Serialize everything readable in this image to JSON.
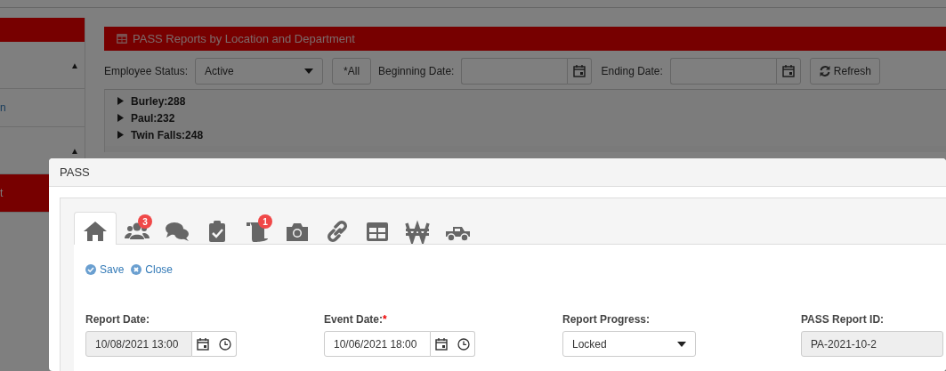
{
  "sidebar": {
    "items": [
      {
        "kind": "group",
        "caret": "▲",
        "selected": false
      },
      {
        "kind": "link",
        "label": "n",
        "selected": false
      },
      {
        "kind": "group",
        "caret": "▲",
        "selected": false
      },
      {
        "kind": "link",
        "label": "t",
        "selected": true
      }
    ]
  },
  "panel": {
    "title": "PASS Reports by Location and Department",
    "filters": {
      "employee_status": {
        "label": "Employee Status:",
        "value": "Active"
      },
      "all_button": "*All",
      "beginning_date": {
        "label": "Beginning Date:"
      },
      "ending_date": {
        "label": "Ending Date:"
      },
      "refresh_button": "Refresh"
    },
    "tree": [
      {
        "label": "Burley:288",
        "expanded": false
      },
      {
        "label": "Paul:232",
        "expanded": false
      },
      {
        "label": "Twin Falls:248",
        "expanded": false
      }
    ]
  },
  "modal": {
    "title": "PASS",
    "tabs": [
      {
        "kind": "home",
        "selected": true
      },
      {
        "kind": "users",
        "badge": "3",
        "selected": false
      },
      {
        "kind": "comments",
        "selected": false
      },
      {
        "kind": "clipboard",
        "selected": false
      },
      {
        "kind": "scroll",
        "badge": "1",
        "selected": false
      },
      {
        "kind": "camera",
        "selected": false
      },
      {
        "kind": "link",
        "selected": false
      },
      {
        "kind": "table",
        "selected": false
      },
      {
        "kind": "won",
        "selected": false
      },
      {
        "kind": "truck",
        "selected": false
      }
    ],
    "actions": [
      {
        "kind": "save",
        "label": "Save"
      },
      {
        "kind": "close",
        "label": "Close"
      }
    ],
    "fields": [
      {
        "kind": "datetime",
        "label": "Report Date:",
        "value": "10/08/2021 13:00",
        "disabled": true
      },
      {
        "kind": "datetime",
        "label": "Event Date:",
        "required_mark": "*",
        "value": "10/06/2021 18:00",
        "disabled": false
      },
      {
        "kind": "select",
        "label": "Report Progress:",
        "value": "Locked",
        "disabled": false
      },
      {
        "kind": "text",
        "label": "PASS Report ID:",
        "value": "PA-2021-10-2",
        "disabled": true
      }
    ]
  }
}
